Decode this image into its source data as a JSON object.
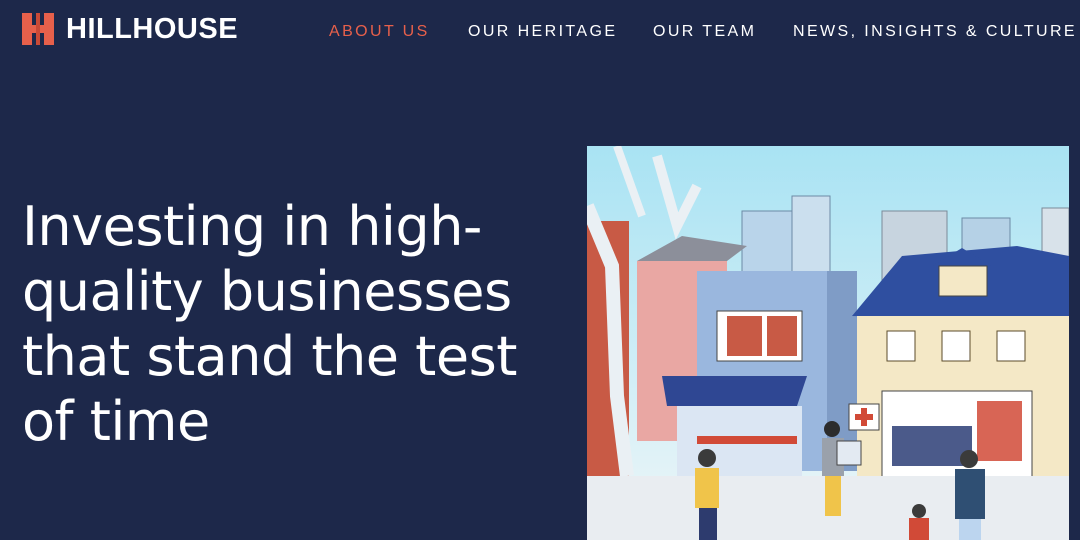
{
  "brand": {
    "name": "HILLHOUSE",
    "accent_color": "#e7604b",
    "background_color": "#1d284a",
    "logo_icon": "hillhouse-h-logo-icon"
  },
  "nav": {
    "items": [
      {
        "label": "ABOUT US",
        "active": true
      },
      {
        "label": "OUR HERITAGE",
        "active": false
      },
      {
        "label": "OUR TEAM",
        "active": false
      },
      {
        "label": "NEWS, INSIGHTS & CULTURE",
        "active": false
      }
    ]
  },
  "hero": {
    "headline": "Investing in high-quality businesses that stand the test of time"
  }
}
